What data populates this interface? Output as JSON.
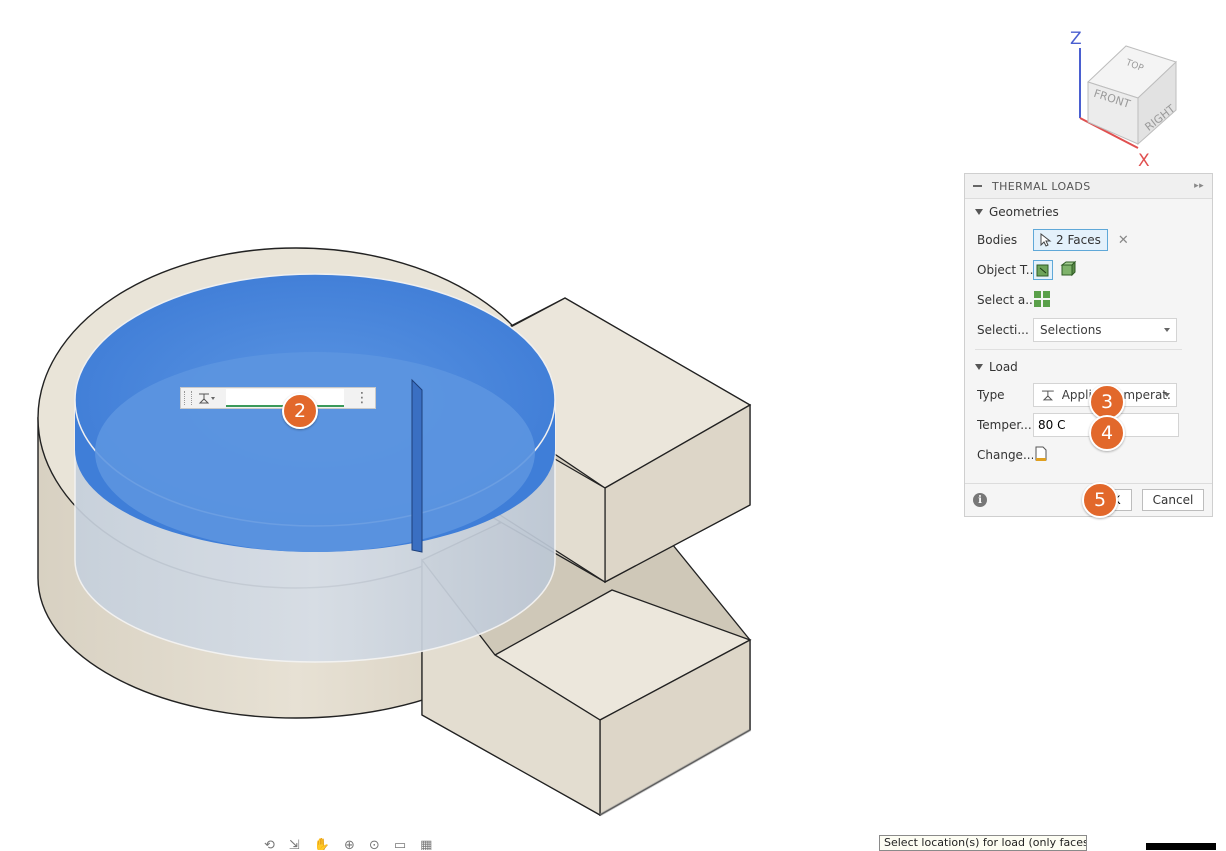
{
  "viewcube": {
    "faces": {
      "top": "TOP",
      "front": "FRONT",
      "right": "RIGHT"
    },
    "axes": {
      "z": "Z",
      "x": "X"
    },
    "colors": {
      "z_axis": "#4a5fd0",
      "x_axis": "#e05050"
    }
  },
  "panel": {
    "title": "THERMAL LOADS",
    "geometries": {
      "heading": "Geometries",
      "bodies_label": "Bodies",
      "bodies_value": "2 Faces",
      "object_type_label": "Object T...",
      "select_all_label": "Select a...",
      "selection_label": "Selecti...",
      "selection_value": "Selections"
    },
    "load": {
      "heading": "Load",
      "type_label": "Type",
      "type_value": "Applied Temperat...",
      "temperature_label": "Temper...",
      "temperature_value": "80 C",
      "change_label": "Change..."
    },
    "footer": {
      "info_icon": "i",
      "ok_label": "OK",
      "cancel_label": "Cancel"
    }
  },
  "callouts": [
    "2",
    "3",
    "4",
    "5"
  ],
  "mini_toolbar": {
    "input_value": ""
  },
  "status_hint": "Select location(s) for load (only faces).",
  "colors": {
    "accent_blue": "#5fa8d8",
    "selected_face": "#4a86dc",
    "body": "#ddd6c8",
    "callout": "#e2682b"
  }
}
